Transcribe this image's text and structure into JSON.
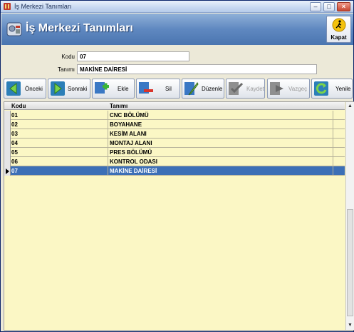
{
  "window": {
    "title": "İş Merkezi Tanımları",
    "controls": {
      "minimize": "–",
      "maximize": "□",
      "close": "×"
    }
  },
  "header": {
    "title": "İş Merkezi Tanımları",
    "close_button_label": "Kapat"
  },
  "form": {
    "code_label": "Kodu",
    "code_value": "07",
    "description_label": "Tanımı",
    "description_value": "MAKİNE DAİRESİ"
  },
  "toolbar": {
    "previous": "Önceki",
    "next": "Sonraki",
    "add": "Ekle",
    "delete": "Sil",
    "edit": "Düzenle",
    "save": "Kaydet",
    "cancel": "Vazgeç",
    "refresh": "Yenile"
  },
  "grid": {
    "columns": [
      "Kodu",
      "Tanımı"
    ],
    "rows": [
      {
        "code": "01",
        "name": "CNC BÖLÜMÜ"
      },
      {
        "code": "02",
        "name": "BOYAHANE"
      },
      {
        "code": "03",
        "name": "KESİM ALANI"
      },
      {
        "code": "04",
        "name": "MONTAJ ALANI"
      },
      {
        "code": "05",
        "name": "PRES BÖLÜMÜ"
      },
      {
        "code": "06",
        "name": "KONTROL ODASI"
      },
      {
        "code": "07",
        "name": "MAKİNE DAİRESİ"
      }
    ],
    "selected_index": 6
  },
  "colors": {
    "header_blue": "#5f88c0",
    "grid_background": "#fbf7c5",
    "selected_row": "#3c6fb6"
  },
  "icons": {
    "app": "app-icon",
    "header": "workcenter-icon",
    "kapat": "exit-icon",
    "previous": "arrow-left-icon",
    "next": "arrow-right-icon",
    "add": "plus-icon",
    "delete": "minus-icon",
    "edit": "pencil-icon",
    "save": "save-check-icon",
    "cancel": "cancel-arrow-icon",
    "refresh": "refresh-icon"
  }
}
